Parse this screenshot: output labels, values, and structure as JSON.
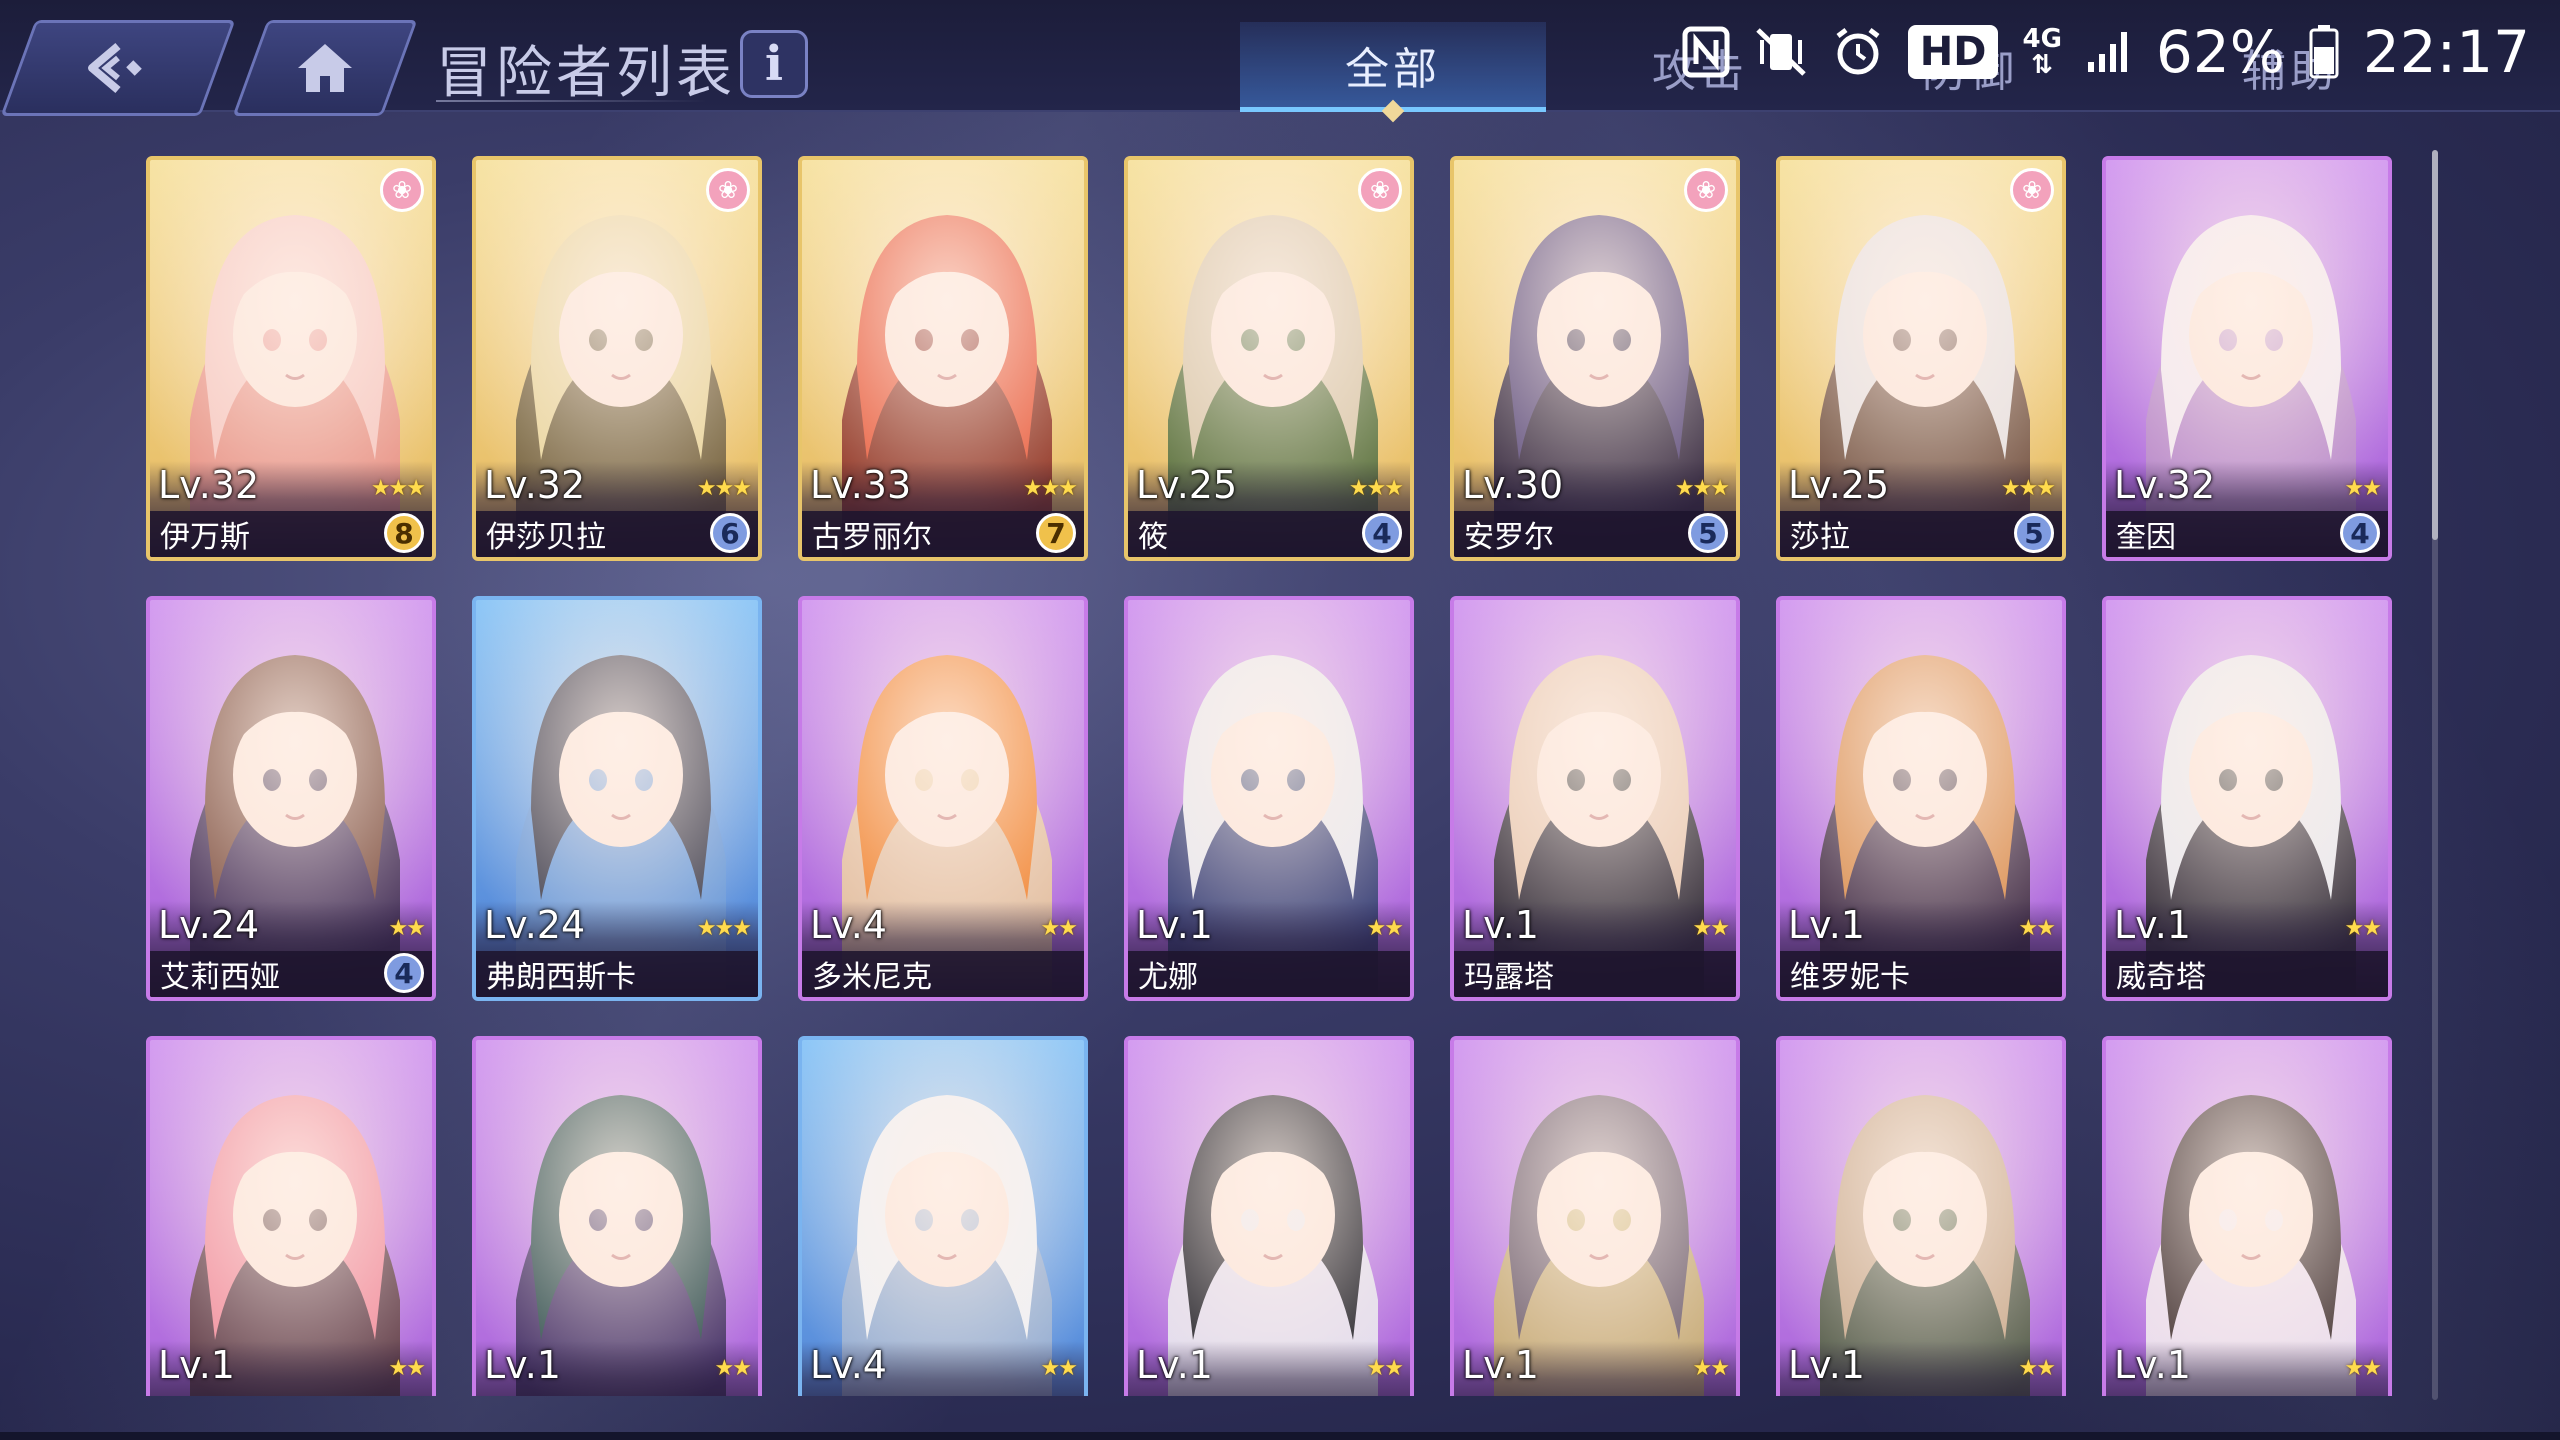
{
  "header": {
    "title": "冒险者列表",
    "info_label": "i",
    "tabs": [
      {
        "label": "全部",
        "active": true
      },
      {
        "label": "攻击",
        "active": false
      },
      {
        "label": "防御",
        "active": false
      },
      {
        "label": "辅助",
        "active": false
      }
    ]
  },
  "status": {
    "nfc_icon": "nfc-icon",
    "mute_icon": "vibrate-mute-icon",
    "alarm_icon": "alarm-icon",
    "hd": "HD",
    "net_type": "4G",
    "battery": "62%",
    "time": "22:17"
  },
  "colors": {
    "gold_frame": "#e8c56a",
    "purple_frame": "#c77be8",
    "blue_frame": "#7ab4f0",
    "tab_active": "#79c8ff"
  },
  "cards": [
    {
      "level": "Lv.32",
      "name": "伊万斯",
      "stars": 3,
      "badge": "8",
      "badge_style": "gold",
      "frame": "gold",
      "paw": true,
      "palette": [
        "#f6c7c0",
        "#e88f8a"
      ]
    },
    {
      "level": "Lv.32",
      "name": "伊莎贝拉",
      "stars": 3,
      "badge": "6",
      "badge_style": "blue",
      "frame": "gold",
      "paw": true,
      "palette": [
        "#e8d49a",
        "#6a5a3a"
      ]
    },
    {
      "level": "Lv.33",
      "name": "古罗丽尔",
      "stars": 3,
      "badge": "7",
      "badge_style": "gold",
      "frame": "gold",
      "paw": false,
      "palette": [
        "#e85a3a",
        "#8a2a20"
      ]
    },
    {
      "level": "Lv.25",
      "name": "筱",
      "stars": 3,
      "badge": "4",
      "badge_style": "blue",
      "frame": "gold",
      "paw": true,
      "palette": [
        "#d8c6a8",
        "#4e6a3a"
      ]
    },
    {
      "level": "Lv.30",
      "name": "安罗尔",
      "stars": 3,
      "badge": "5",
      "badge_style": "blue",
      "frame": "gold",
      "paw": true,
      "palette": [
        "#5a4a7a",
        "#2a2040"
      ]
    },
    {
      "level": "Lv.25",
      "name": "莎拉",
      "stars": 3,
      "badge": "5",
      "badge_style": "blue",
      "frame": "gold",
      "paw": true,
      "palette": [
        "#e6e0e0",
        "#6a4a40"
      ]
    },
    {
      "level": "Lv.32",
      "name": "奎因",
      "stars": 2,
      "badge": "4",
      "badge_style": "blue",
      "frame": "purple",
      "paw": false,
      "palette": [
        "#f2e8f0",
        "#b98cc8"
      ]
    },
    {
      "level": "Lv.24",
      "name": "艾莉西娅",
      "stars": 2,
      "badge": "4",
      "badge_style": "blue",
      "frame": "purple",
      "paw": false,
      "palette": [
        "#7a4a3a",
        "#3a2a4a"
      ]
    },
    {
      "level": "Lv.24",
      "name": "弗朗西斯卡",
      "stars": 3,
      "badge": "",
      "badge_style": "none",
      "frame": "blue",
      "paw": false,
      "palette": [
        "#3a3a4a",
        "#6a9ad8"
      ]
    },
    {
      "level": "Lv.4",
      "name": "多米尼克",
      "stars": 2,
      "badge": "",
      "badge_style": "none",
      "frame": "purple",
      "paw": false,
      "palette": [
        "#f0802a",
        "#e8c89a"
      ]
    },
    {
      "level": "Lv.1",
      "name": "尤娜",
      "stars": 2,
      "badge": "",
      "badge_style": "none",
      "frame": "purple",
      "paw": false,
      "palette": [
        "#e8e8ee",
        "#2a3a6a"
      ]
    },
    {
      "level": "Lv.1",
      "name": "玛露塔",
      "stars": 2,
      "badge": "",
      "badge_style": "none",
      "frame": "purple",
      "paw": false,
      "palette": [
        "#e8c8b0",
        "#2a2a2a"
      ]
    },
    {
      "level": "Lv.1",
      "name": "维罗妮卡",
      "stars": 2,
      "badge": "",
      "badge_style": "none",
      "frame": "purple",
      "paw": false,
      "palette": [
        "#d88a4a",
        "#3a2a3a"
      ]
    },
    {
      "level": "Lv.1",
      "name": "威奇塔",
      "stars": 2,
      "badge": "",
      "badge_style": "none",
      "frame": "purple",
      "paw": false,
      "palette": [
        "#e8e8ee",
        "#2a2a2a"
      ]
    },
    {
      "level": "Lv.1",
      "name": "",
      "stars": 2,
      "badge": "",
      "badge_style": "none",
      "frame": "purple",
      "paw": false,
      "palette": [
        "#f08a9a",
        "#5a3a3a"
      ]
    },
    {
      "level": "Lv.1",
      "name": "",
      "stars": 2,
      "badge": "",
      "badge_style": "none",
      "frame": "purple",
      "paw": false,
      "palette": [
        "#2a4a4a",
        "#3a2a5a"
      ]
    },
    {
      "level": "Lv.4",
      "name": "",
      "stars": 2,
      "badge": "",
      "badge_style": "none",
      "frame": "blue",
      "paw": false,
      "palette": [
        "#eef0f4",
        "#9ab0d0"
      ]
    },
    {
      "level": "Lv.1",
      "name": "",
      "stars": 2,
      "badge": "",
      "badge_style": "none",
      "frame": "purple",
      "paw": false,
      "palette": [
        "#1a1a22",
        "#e8e8ee"
      ]
    },
    {
      "level": "Lv.1",
      "name": "",
      "stars": 2,
      "badge": "",
      "badge_style": "none",
      "frame": "purple",
      "paw": false,
      "palette": [
        "#6a5a6a",
        "#c8b06a"
      ]
    },
    {
      "level": "Lv.1",
      "name": "",
      "stars": 2,
      "badge": "",
      "badge_style": "none",
      "frame": "purple",
      "paw": false,
      "palette": [
        "#c8a88a",
        "#4a5a3a"
      ]
    },
    {
      "level": "Lv.1",
      "name": "",
      "stars": 2,
      "badge": "",
      "badge_style": "none",
      "frame": "purple",
      "paw": false,
      "palette": [
        "#3a2a2a",
        "#f0e8ee"
      ]
    }
  ]
}
